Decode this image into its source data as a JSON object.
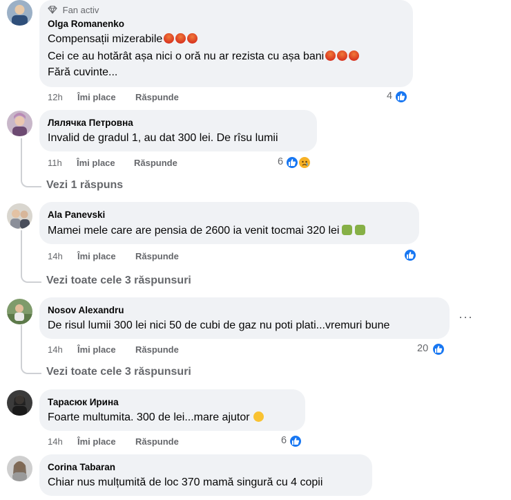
{
  "comments": [
    {
      "badge": "Fan activ",
      "name": "Olga Romanenko",
      "lines": [
        "Compensații mizerabile",
        "Cei ce au hotărât așa nici o oră nu ar rezista cu așa bani",
        "Fără cuvinte..."
      ],
      "time": "12h",
      "like": "Îmi place",
      "reply": "Răspunde",
      "reactions": "4"
    },
    {
      "name": "Лялячка Петровна",
      "lines": [
        "Invalid de gradul 1, au dat 300 lei. De rîsu lumii"
      ],
      "time": "11h",
      "like": "Îmi place",
      "reply": "Răspunde",
      "reactions": "6",
      "replies_link": "Vezi 1 răspuns"
    },
    {
      "name": "Ala Panevski",
      "lines": [
        "Mamei mele care are pensia de 2600 ia venit tocmai 320 lei"
      ],
      "time": "14h",
      "like": "Îmi place",
      "reply": "Răspunde",
      "reactions": "",
      "replies_link": "Vezi toate cele 3 răspunsuri"
    },
    {
      "name": "Nosov Alexandru",
      "lines": [
        "De risul lumii 300 lei nici 50 de cubi de gaz nu poti plati...vremuri bune"
      ],
      "time": "14h",
      "like": "Îmi place",
      "reply": "Răspunde",
      "reactions": "20",
      "replies_link": "Vezi toate cele 3 răspunsuri"
    },
    {
      "name": "Тарасюк Ирина",
      "lines": [
        "Foarte multumita. 300 de lei...mare ajutor"
      ],
      "time": "14h",
      "like": "Îmi place",
      "reply": "Răspunde",
      "reactions": "6"
    },
    {
      "name": "Corina Tabaran",
      "lines": [
        "Chiar nus mulțumită de loc 370 mamă singură cu 4 copii"
      ]
    }
  ],
  "more_menu": "···",
  "colors": {
    "bubble": "#f0f2f5",
    "like": "#1877f2",
    "meta": "#65676b",
    "thread": "#ced0d4"
  },
  "icons": {
    "badge": "diamond-icon",
    "like": "thumbs-up-icon",
    "sad": "sad-face-icon"
  }
}
